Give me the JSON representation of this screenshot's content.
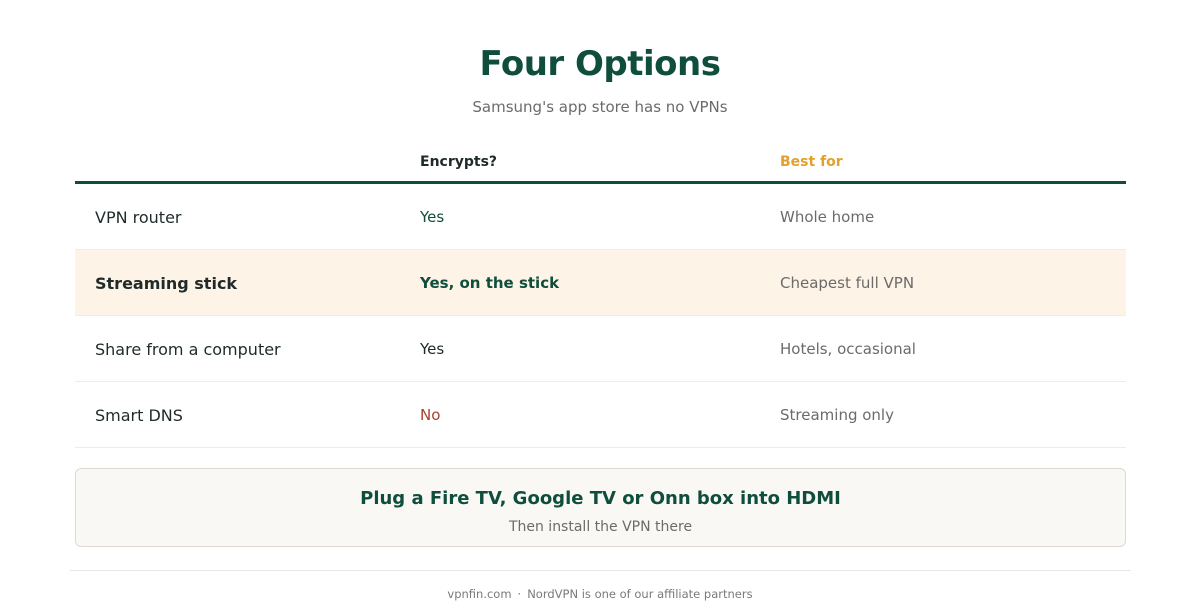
{
  "header": {
    "title": "Four Options",
    "subtitle": "Samsung's app store has no VPNs"
  },
  "table": {
    "columns": [
      "",
      "Encrypts?",
      "Best for"
    ],
    "rows": [
      {
        "name": "VPN router",
        "encrypts": "Yes",
        "best_for": "Whole home",
        "highlighted": false
      },
      {
        "name": "Streaming stick",
        "encrypts": "Yes, on the stick",
        "best_for": "Cheapest full VPN",
        "highlighted": true
      },
      {
        "name": "Share from a computer",
        "encrypts": "Yes",
        "best_for": "Hotels, occasional",
        "highlighted": false
      },
      {
        "name": "Smart DNS",
        "encrypts": "No",
        "best_for": "Streaming only",
        "highlighted": false
      }
    ]
  },
  "callout": {
    "title": "Plug a Fire TV, Google TV or Onn box into HDMI",
    "subtitle": "Then install the VPN there"
  },
  "footer": {
    "site": "vpnfin.com",
    "separator": "·",
    "note": "NordVPN is one of our affiliate partners"
  },
  "colors": {
    "brand_green": "#0f4d3c",
    "accent_orange": "#e3a02b",
    "negative_red": "#a5432b",
    "highlight_bg": "#fdf3e6"
  }
}
